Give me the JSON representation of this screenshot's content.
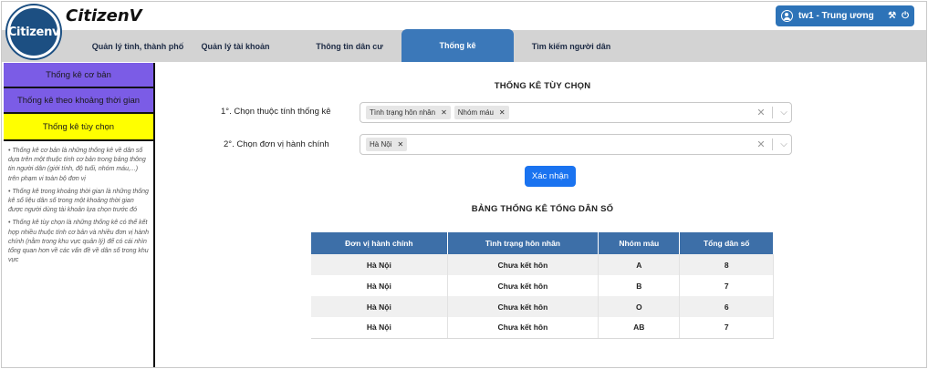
{
  "app": {
    "logo_text": "Citizenv",
    "brand": "CitizenV"
  },
  "user": {
    "name": "tw1 - Trung ương",
    "icons": [
      "user-icon",
      "tools-icon",
      "logout-icon"
    ]
  },
  "nav": {
    "items": [
      {
        "label": "Quản lý tỉnh, thành phố"
      },
      {
        "label": "Quản lý tài khoản"
      },
      {
        "label": "Thông tin dân cư"
      },
      {
        "label": "Thống kê"
      },
      {
        "label": "Tìm kiếm người dân"
      }
    ],
    "active": "Thống kê"
  },
  "sidebar": {
    "buttons": [
      {
        "label": "Thống kê cơ bản"
      },
      {
        "label": "Thống kê theo khoảng thời gian"
      },
      {
        "label": "Thống kê tùy chọn"
      }
    ],
    "notes": [
      "• Thống kê cơ bản là những thống kê về dân số dựa trên một thuộc tính cơ bản trong bảng thông tin người dân (giới tính, độ tuổi, nhóm máu,...) trên phạm vi toàn bộ đơn vị",
      "• Thống kê trong khoảng thời gian là những thống kê số liệu dân số trong một khoảng thời gian được người dùng tài khoản lựa chọn trước đó",
      "• Thống kê tùy chọn là những thống kê có thể kết hợp nhiều thuộc tính cơ bản và nhiều đơn vị hành chính (nằm trong khu vực quản lý) để có cái nhìn tổng quan hơn về các vấn đề về dân số trong khu vực"
    ]
  },
  "main": {
    "title": "THỐNG KÊ TÙY CHỌN",
    "attr_label": "1°. Chọn thuộc tính thống kê",
    "attr_tags": [
      "Tình trạng hôn nhân",
      "Nhóm máu"
    ],
    "unit_label": "2°. Chọn đơn vị hành chính",
    "unit_tags": [
      "Hà Nội"
    ],
    "confirm": "Xác nhận",
    "table_title": "BẢNG THỐNG KÊ TỔNG DÂN SỐ",
    "table": {
      "headers": [
        "Đơn vị hành chính",
        "Tình trạng hôn nhân",
        "Nhóm máu",
        "Tổng dân số"
      ],
      "rows": [
        [
          "Hà Nội",
          "Chưa kết hôn",
          "A",
          "8"
        ],
        [
          "Hà Nội",
          "Chưa kết hôn",
          "B",
          "7"
        ],
        [
          "Hà Nội",
          "Chưa kết hôn",
          "O",
          "6"
        ],
        [
          "Hà Nội",
          "Chưa kết hôn",
          "AB",
          "7"
        ]
      ]
    }
  },
  "colors": {
    "nav_active": "#3b78b9",
    "sidebar_purple": "#7b5ce6",
    "sidebar_active": "#ffff00",
    "confirm": "#1a73f0",
    "table_header": "#3d6fa8"
  }
}
